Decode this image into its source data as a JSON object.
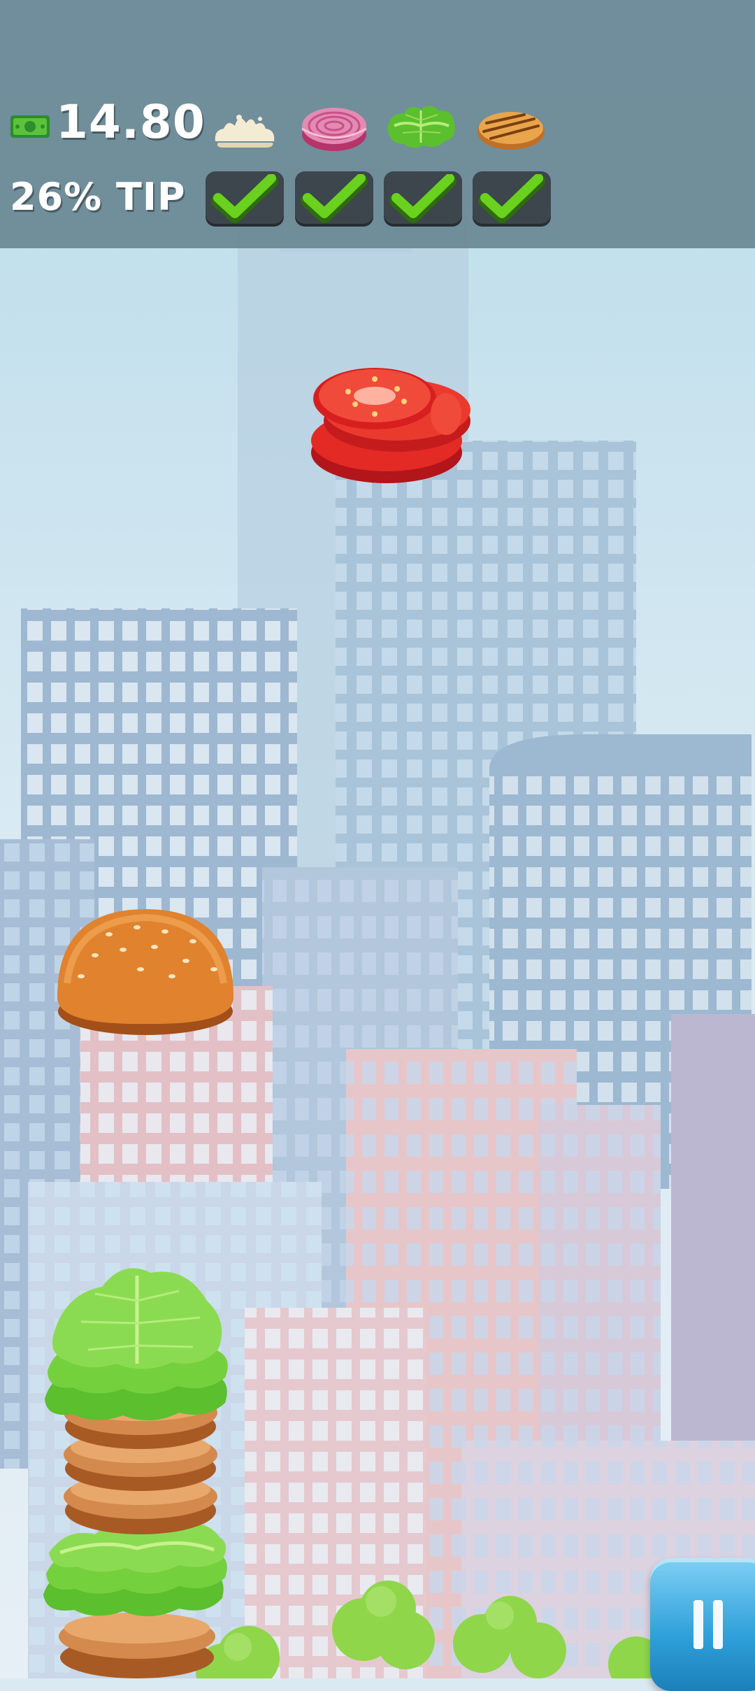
{
  "hud": {
    "money": "14.80",
    "tip": "26% TIP",
    "order_ingredients": [
      {
        "icon": "mayo-icon"
      },
      {
        "icon": "onion-icon"
      },
      {
        "icon": "lettuce-icon"
      },
      {
        "icon": "bun-icon"
      }
    ],
    "order_checks": [
      {
        "icon": "checkmark-icon",
        "done": true
      },
      {
        "icon": "checkmark-icon",
        "done": true
      },
      {
        "icon": "checkmark-icon",
        "done": true
      },
      {
        "icon": "checkmark-icon",
        "done": true
      }
    ]
  },
  "scene": {
    "falling_item": "tomato-slices-icon",
    "moving_item": "bun-top-icon",
    "stack": [
      "lettuce",
      "patty",
      "patty",
      "patty",
      "lettuce",
      "patty"
    ]
  },
  "controls": {
    "pause_icon": "pause-icon"
  },
  "colors": {
    "hud_background": "#6a8894",
    "check_green": "#6ad11e",
    "sky": "#dbe9f3"
  }
}
